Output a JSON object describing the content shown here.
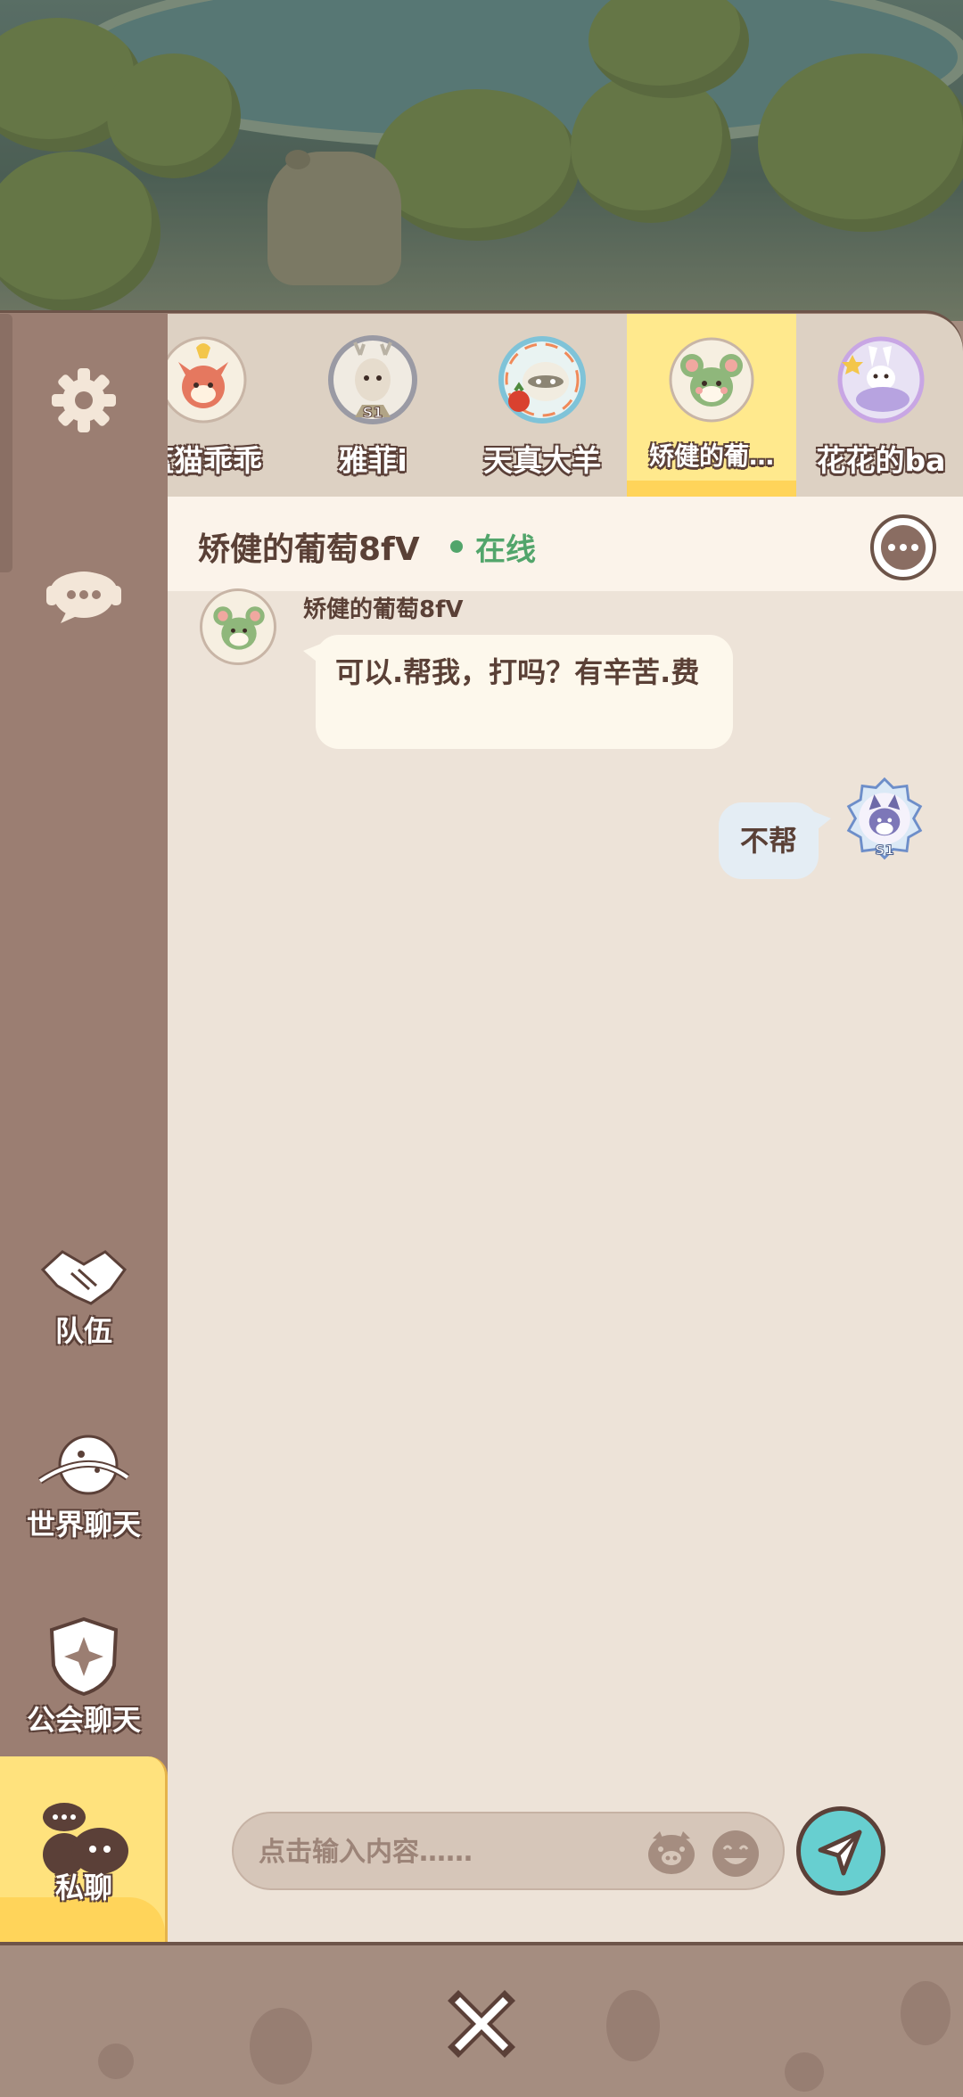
{
  "sidebar": {
    "settings_icon": "gear-icon",
    "support_icon": "headset-chat-icon",
    "items": [
      {
        "label": "队伍",
        "icon": "handshake-icon"
      },
      {
        "label": "世界聊天",
        "icon": "planet-icon"
      },
      {
        "label": "公会聊天",
        "icon": "guild-shield-icon"
      },
      {
        "label": "私聊",
        "icon": "private-chat-icon",
        "active": true
      }
    ]
  },
  "contacts": [
    {
      "name": "蓝猫乖乖",
      "avatar": "fox-avatar"
    },
    {
      "name": "雅菲i",
      "avatar": "deer-avatar",
      "badge": "S1"
    },
    {
      "name": "天真大羊",
      "avatar": "raccoon-avatar"
    },
    {
      "name": "矫健的葡…",
      "avatar": "mouse-avatar",
      "selected": true
    },
    {
      "name": "花花的ba",
      "avatar": "bunny-avatar"
    }
  ],
  "chat_header": {
    "peer_name": "矫健的葡萄8fV",
    "status": "在线"
  },
  "messages": [
    {
      "sender": "矫健的葡萄8fV",
      "text": "可以.帮我，打吗？有辛苦.费",
      "direction": "in"
    },
    {
      "text": "不帮",
      "direction": "out",
      "badge": "S1"
    }
  ],
  "input": {
    "placeholder": "点击输入内容……"
  },
  "colors": {
    "accent_yellow": "#ffe27d",
    "online_green": "#52a56b",
    "send_teal": "#67cfd0",
    "brown_outline": "#5b4038"
  }
}
